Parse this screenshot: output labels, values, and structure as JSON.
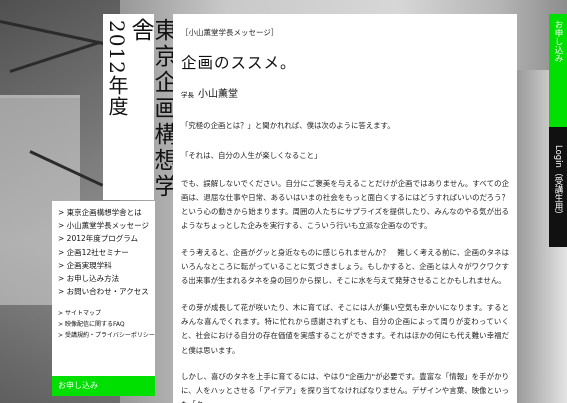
{
  "title": {
    "col1": "東京企画構想学舎",
    "col2": "2012年度"
  },
  "nav": {
    "main_items": [
      "東京企画構想学舎とは",
      "小山薫堂学長メッセージ",
      "2012年度プログラム",
      "企画12社セミナー",
      "企画実現学科",
      "お申し込み方法",
      "お問い合わせ・アクセス"
    ],
    "sub_items": [
      "サイトマップ",
      "映像配信に関するFAQ",
      "受講規約・プライバシーポリシー"
    ],
    "apply_label": "お申し込み"
  },
  "side": {
    "apply_label": "お申し込み",
    "login_label": "Login（受講生用）"
  },
  "content": {
    "breadcrumb": "［小山薫堂学長メッセージ］",
    "heading": "企画のススメ。",
    "author_role": "学長",
    "author_name": "小山薫堂",
    "paragraphs": [
      "「究極の企画とは？」と聞かれれば、僕は次のように答えます。",
      "「それは、自分の人生が楽しくなること」",
      "でも、誤解しないでください。自分にご褒美を与えることだけが企画ではありません。すべての企画は、退屈な仕事や日常、あるいはいまの社会をもっと面白くするにはどうすればいいのだろう？という心の動きから始まります。周囲の人たちにサプライズを提供したり、みんなのやる気が出るようなちょっとした企みを実行する、こういう行いも立派な企画なのです。",
      "そう考えると、企画がグッと身近なものに感じられませんか？　難しく考える前に、企画のタネはいろんなところに転がっていることに気づきましょう。もしかすると、企画とは人々がワクワクする出来事が生まれるタネを身の回りから探し、そこに水を与えて発芽させることかもしれません。",
      "その芽が成長して花が咲いたり、木に育てば、そこには人が集い空気も幸かいになります。するとみんな喜んでくれます。特に忙れから感謝されずとも、自分の企画によって周りが変わっていくと、社会における自分の存在価値を実感することができます。それはほかの何にも代え難い幸福だと僕は思います。",
      "しかし、喜びのタネを上手に育てるには、やはり\"企画力\"が必要です。豊富な「情報」を手がかりに、人をハッとさせる「アイデア」を探り当てなければなりません。デザインや言葉、映像といった「ク"
    ]
  }
}
